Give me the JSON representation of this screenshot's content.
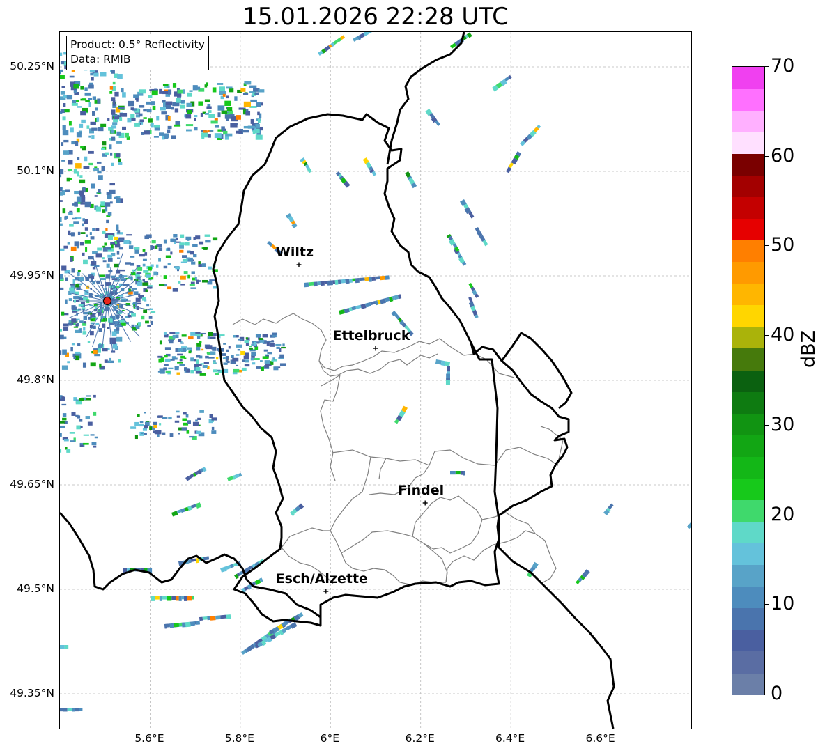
{
  "title": "15.01.2026 22:28 UTC",
  "info": {
    "product": "Product: 0.5° Reflectivity",
    "source": "Data: RMIB"
  },
  "map_extent": {
    "lon_min": 5.4,
    "lon_max": 6.8,
    "lat_min": 49.3,
    "lat_max": 50.3
  },
  "lat_ticks": [
    {
      "value": 50.25,
      "label": "50.25°N"
    },
    {
      "value": 50.1,
      "label": "50.1°N"
    },
    {
      "value": 49.95,
      "label": "49.95°N"
    },
    {
      "value": 49.8,
      "label": "49.8°N"
    },
    {
      "value": 49.65,
      "label": "49.65°N"
    },
    {
      "value": 49.5,
      "label": "49.5°N"
    },
    {
      "value": 49.35,
      "label": "49.35°N"
    }
  ],
  "lon_ticks": [
    {
      "value": 5.6,
      "label": "5.6°E"
    },
    {
      "value": 5.8,
      "label": "5.8°E"
    },
    {
      "value": 6.0,
      "label": "6°E"
    },
    {
      "value": 6.2,
      "label": "6.2°E"
    },
    {
      "value": 6.4,
      "label": "6.4°E"
    },
    {
      "value": 6.6,
      "label": "6.6°E"
    }
  ],
  "cities": [
    {
      "name": "Wiltz",
      "lon": 5.93,
      "lat": 49.966
    },
    {
      "name": "Ettelbruck",
      "lon": 6.1,
      "lat": 49.846
    },
    {
      "name": "Findel",
      "lon": 6.21,
      "lat": 49.624
    },
    {
      "name": "Esch/Alzette",
      "lon": 5.99,
      "lat": 49.497
    }
  ],
  "radar_site": {
    "lon": 5.505,
    "lat": 49.914,
    "color": "#e8261b"
  },
  "colorbar": {
    "label": "dBZ",
    "min": 0,
    "max": 70,
    "ticks": [
      0,
      10,
      20,
      30,
      40,
      50,
      60,
      70
    ],
    "colors": [
      "#6b7fa8",
      "#5a6da3",
      "#4a5fa0",
      "#4a74ad",
      "#4d8cbd",
      "#58a3c8",
      "#64c2db",
      "#5fd9c8",
      "#3fd96c",
      "#17c91b",
      "#13b717",
      "#12a614",
      "#119412",
      "#0e7b11",
      "#0b6110",
      "#467a0c",
      "#aab30a",
      "#ffd600",
      "#ffb600",
      "#ff9a00",
      "#ff7f00",
      "#e60000",
      "#c40000",
      "#a30000",
      "#7a0000",
      "#ffe0ff",
      "#ffb0ff",
      "#ff70ff",
      "#f040f0"
    ]
  },
  "map_colors": {
    "border": "#000000",
    "districts": "#808080",
    "grid": "#b8b8b8"
  }
}
